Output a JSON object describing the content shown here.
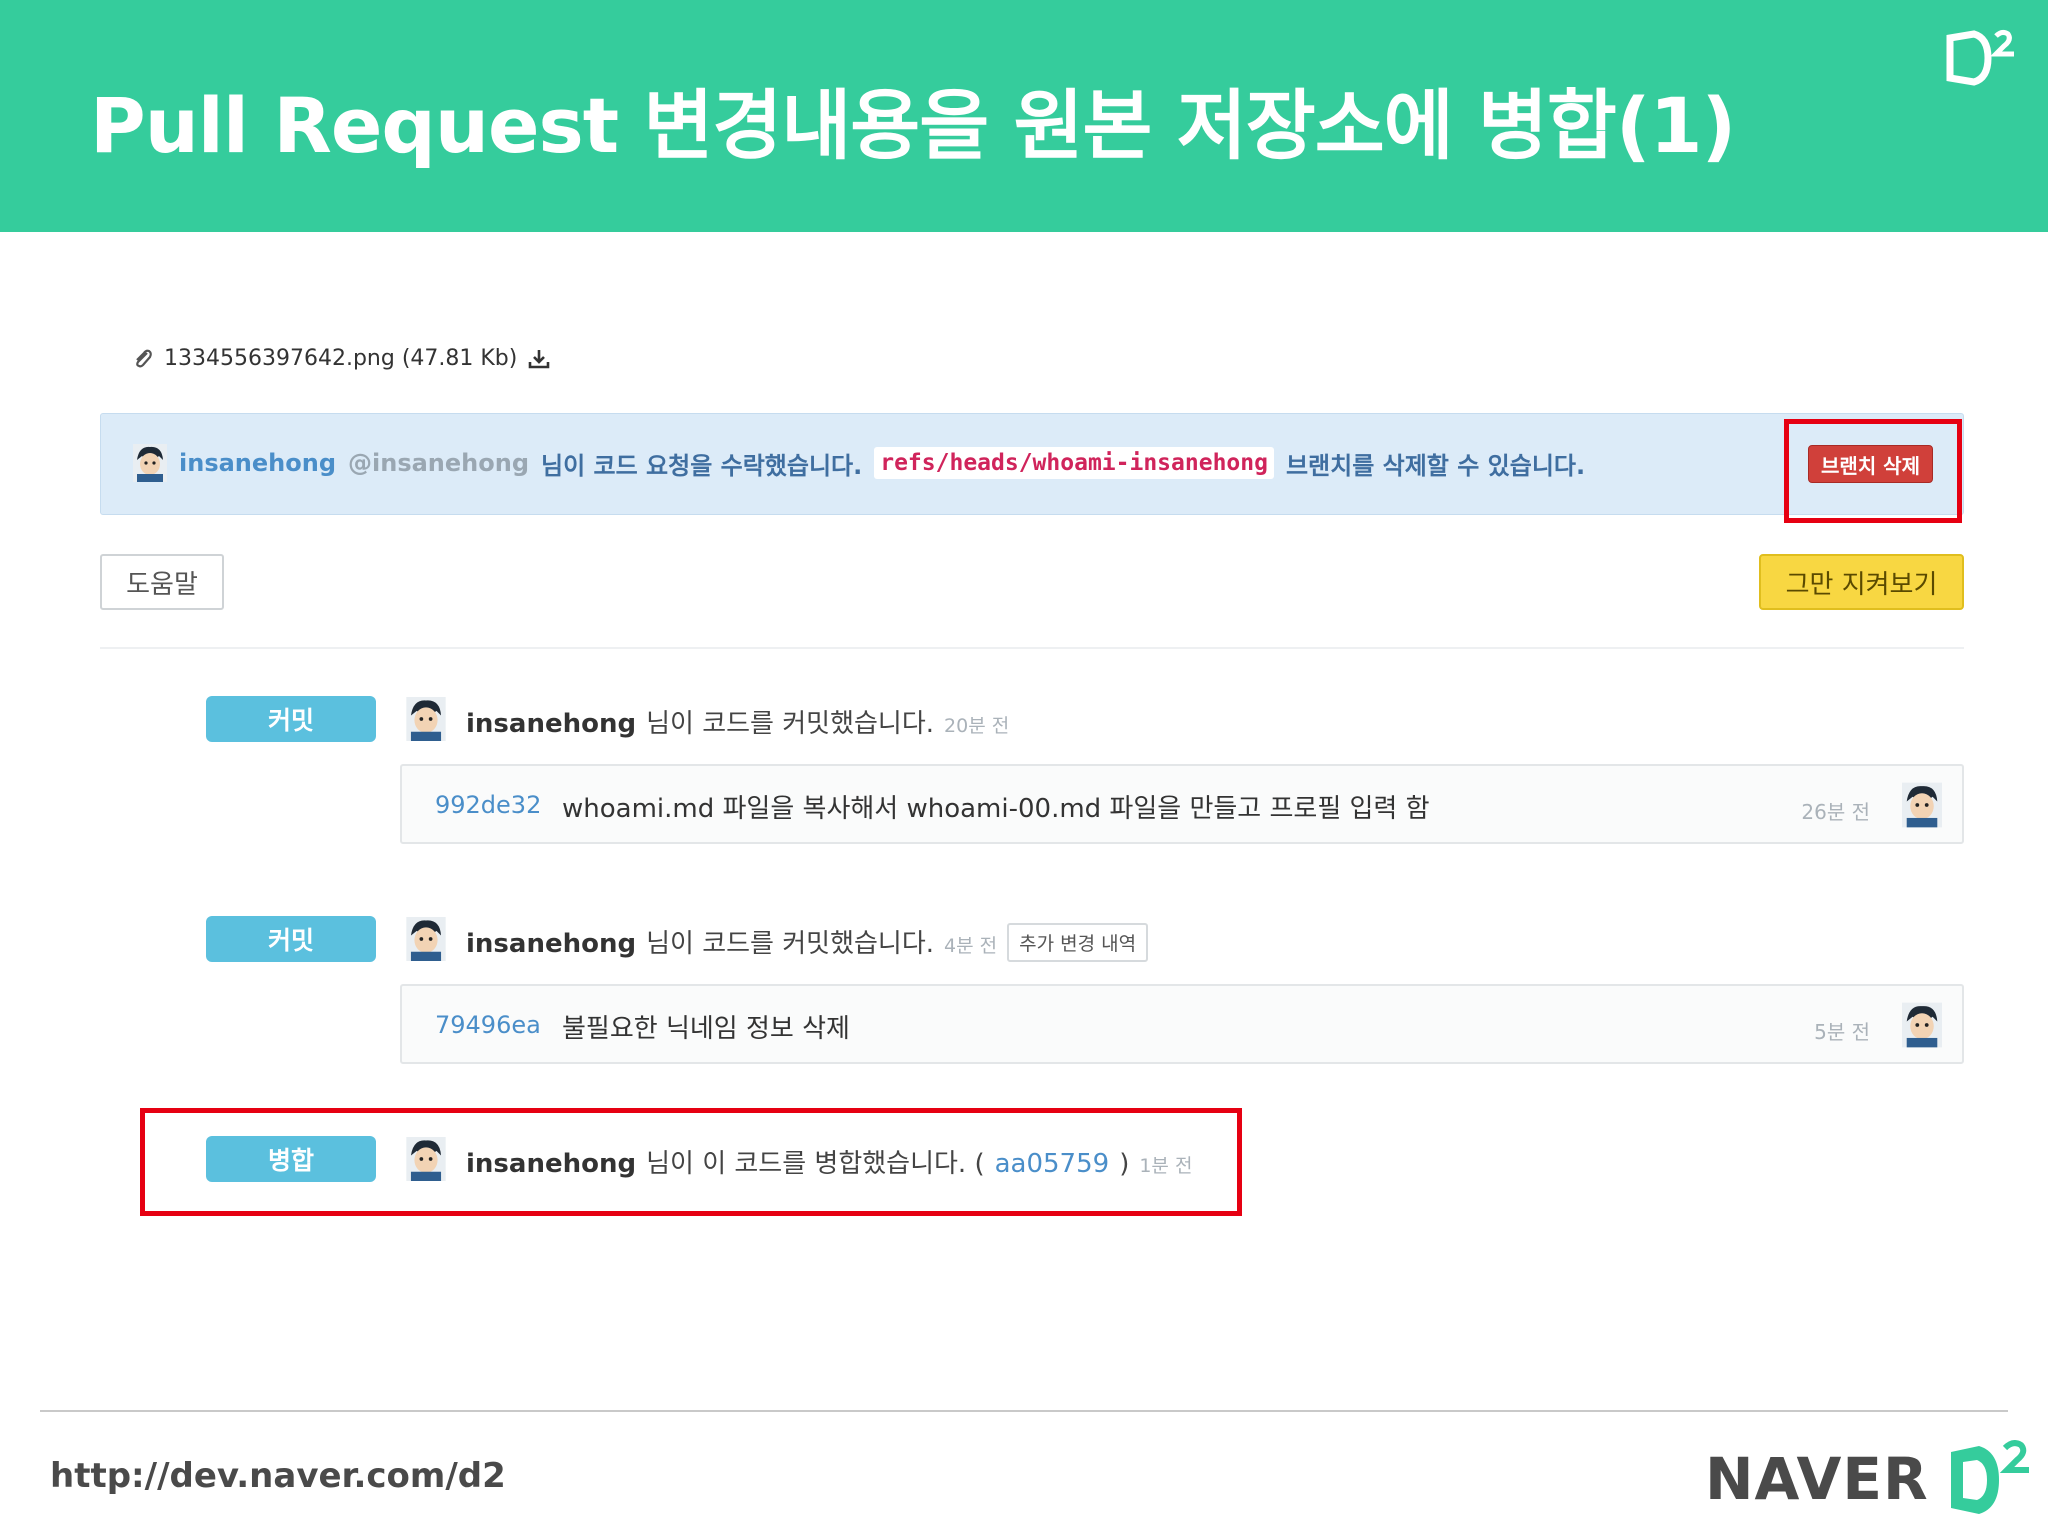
{
  "slide": {
    "title": "Pull Request 변경내용을 원본 저장소에 병합(1)",
    "footer_url": "http://dev.naver.com/d2",
    "footer_brand": "NAVER"
  },
  "colors": {
    "header_bg": "#35cc9c",
    "highlight": "#e60012",
    "label_bg": "#5bc0de",
    "unwatch_bg": "#f8d742",
    "delete_bg": "#d0403a"
  },
  "attachment": {
    "filename": "1334556397642.png (47.81 Kb)",
    "icon": "paperclip-icon",
    "download_icon": "download-icon"
  },
  "notice": {
    "user": "insanehong",
    "handle": "@insanehong",
    "text_before": "님이 코드 요청을 수락했습니다.",
    "branch": "refs/heads/whoami-insanehong",
    "text_after": "브랜치를 삭제할 수 있습니다.",
    "delete_button": "브랜치 삭제"
  },
  "toolbar": {
    "help_label": "도움말",
    "unwatch_label": "그만 지켜보기"
  },
  "timeline": [
    {
      "label": "커밋",
      "user": "insanehong",
      "text": "님이 코드를 커밋했습니다.",
      "time": "20분 전",
      "commit": {
        "sha": "992de32",
        "message": "whoami.md 파일을 복사해서 whoami-00.md 파일을 만들고 프로필 입력 함",
        "time": "26분 전"
      }
    },
    {
      "label": "커밋",
      "user": "insanehong",
      "text": "님이 코드를 커밋했습니다.",
      "time": "4분 전",
      "extra_button": "추가 변경 내역",
      "commit": {
        "sha": "79496ea",
        "message": "불필요한 닉네임 정보 삭제",
        "time": "5분 전"
      }
    },
    {
      "label": "병합",
      "user": "insanehong",
      "text": "님이 이 코드를 병합했습니다. (",
      "merge_sha": "aa05759",
      "text_close": ")",
      "time": "1분 전"
    }
  ]
}
